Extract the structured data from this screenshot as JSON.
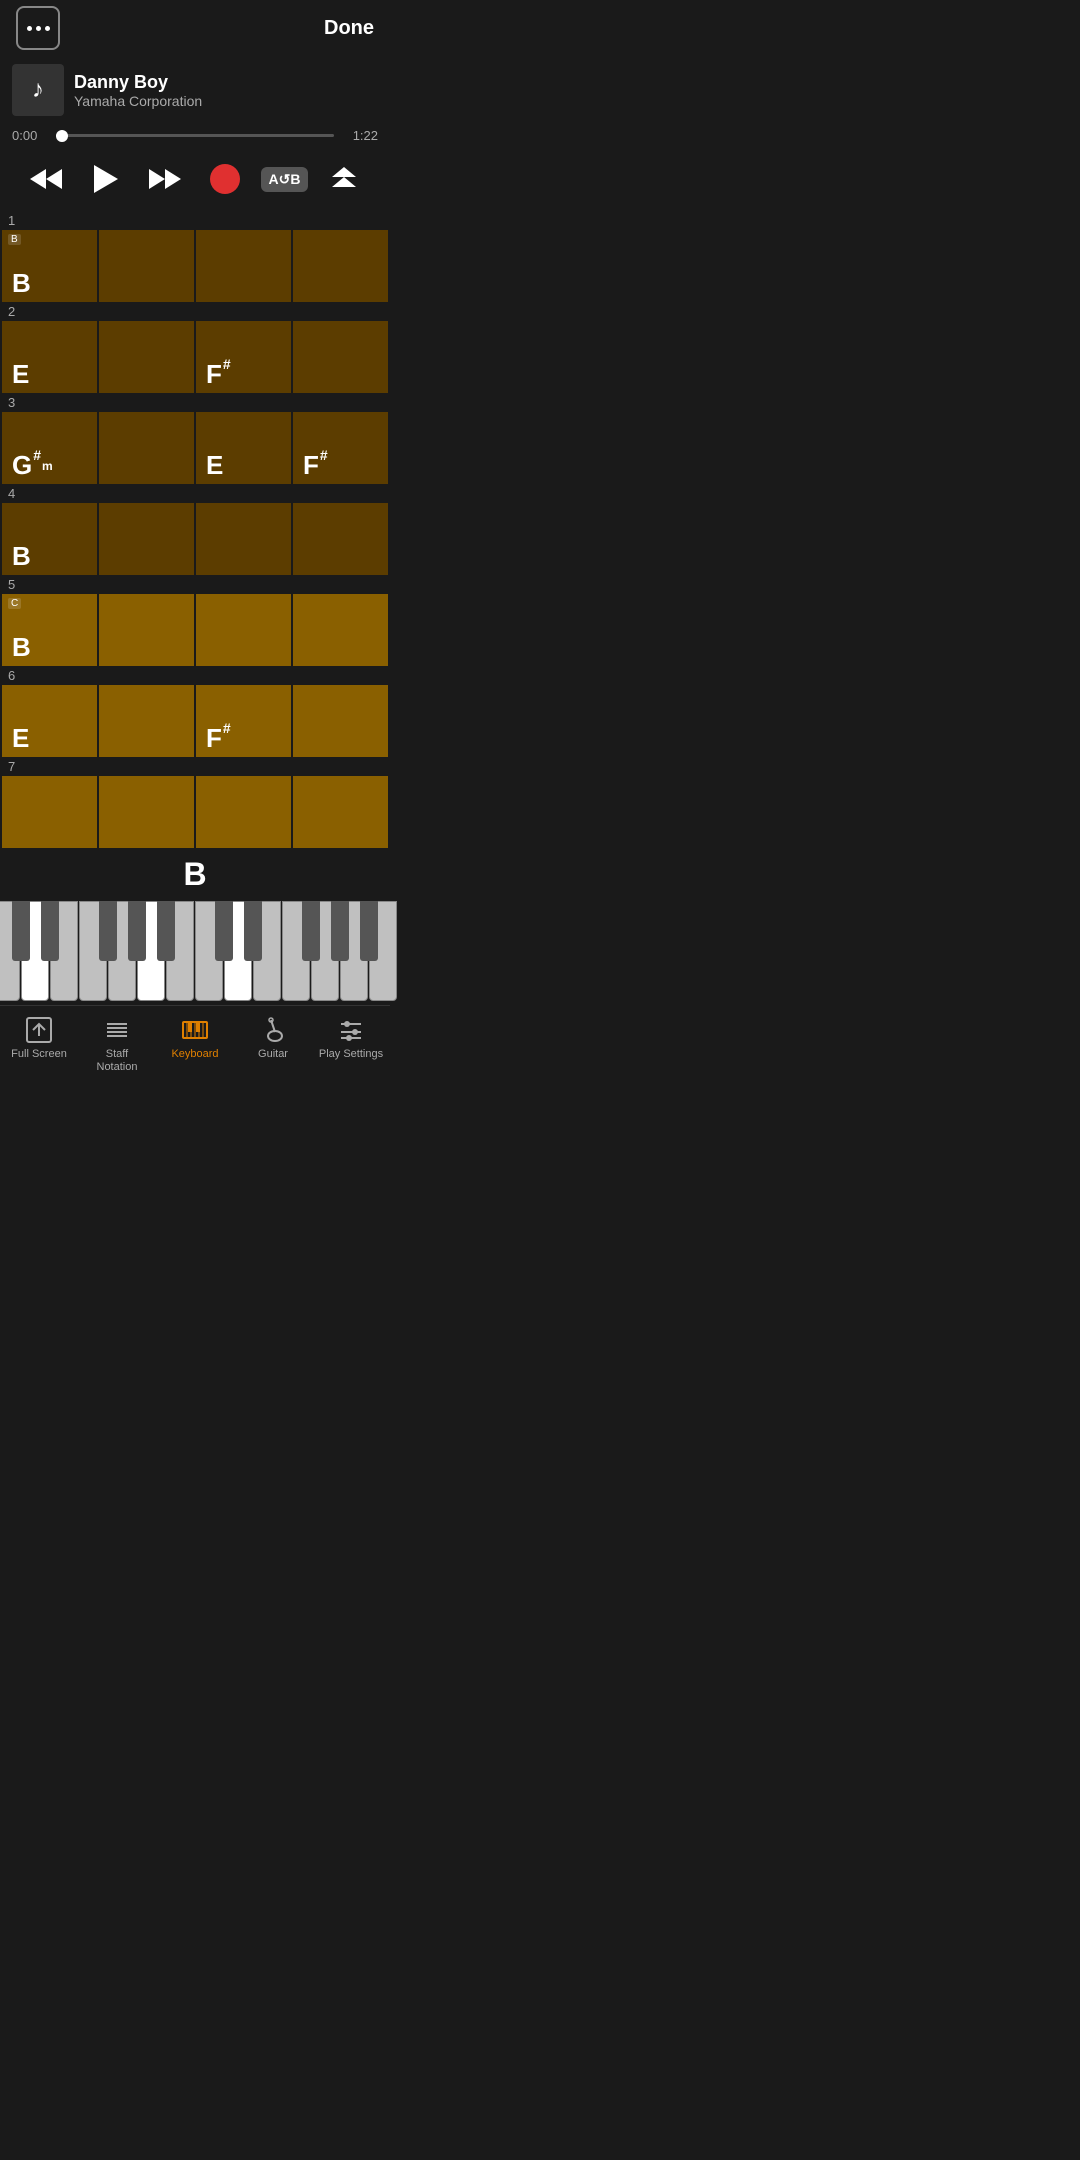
{
  "header": {
    "menu_label": "menu",
    "done_label": "Done"
  },
  "player": {
    "title": "Danny Boy",
    "artist": "Yamaha Corporation",
    "time_current": "0:00",
    "time_total": "1:22",
    "progress_percent": 2
  },
  "controls": {
    "rewind_label": "Rewind",
    "play_label": "Play",
    "fastforward_label": "Fast Forward",
    "record_label": "Record",
    "ab_label": "A↺B",
    "scroll_label": "Scroll"
  },
  "chord_grid": {
    "rows": [
      {
        "number": "1",
        "section": "B",
        "cells": [
          {
            "label": "B",
            "sharp": "",
            "sub": "",
            "style": "dark",
            "section": "B"
          },
          {
            "label": "",
            "sharp": "",
            "sub": "",
            "style": "dark"
          },
          {
            "label": "",
            "sharp": "",
            "sub": "",
            "style": "dark"
          },
          {
            "label": "",
            "sharp": "",
            "sub": "",
            "style": "dark"
          }
        ]
      },
      {
        "number": "2",
        "cells": [
          {
            "label": "E",
            "sharp": "",
            "sub": "",
            "style": "dark"
          },
          {
            "label": "",
            "sharp": "",
            "sub": "",
            "style": "dark"
          },
          {
            "label": "F",
            "sharp": "#",
            "sub": "",
            "style": "dark"
          },
          {
            "label": "",
            "sharp": "",
            "sub": "",
            "style": "dark"
          }
        ]
      },
      {
        "number": "3",
        "cells": [
          {
            "label": "G",
            "sharp": "#",
            "sub": "m",
            "style": "dark"
          },
          {
            "label": "",
            "sharp": "",
            "sub": "",
            "style": "dark"
          },
          {
            "label": "E",
            "sharp": "",
            "sub": "",
            "style": "dark"
          },
          {
            "label": "F",
            "sharp": "#",
            "sub": "",
            "style": "dark"
          }
        ]
      },
      {
        "number": "4",
        "cells": [
          {
            "label": "B",
            "sharp": "",
            "sub": "",
            "style": "dark"
          },
          {
            "label": "",
            "sharp": "",
            "sub": "",
            "style": "dark"
          },
          {
            "label": "",
            "sharp": "",
            "sub": "",
            "style": "dark"
          },
          {
            "label": "",
            "sharp": "",
            "sub": "",
            "style": "dark"
          }
        ]
      },
      {
        "number": "5",
        "section": "C",
        "cells": [
          {
            "label": "B",
            "sharp": "",
            "sub": "",
            "style": "medium",
            "section": "C"
          },
          {
            "label": "",
            "sharp": "",
            "sub": "",
            "style": "medium"
          },
          {
            "label": "",
            "sharp": "",
            "sub": "",
            "style": "medium"
          },
          {
            "label": "",
            "sharp": "",
            "sub": "",
            "style": "medium"
          }
        ]
      },
      {
        "number": "6",
        "cells": [
          {
            "label": "E",
            "sharp": "",
            "sub": "",
            "style": "medium"
          },
          {
            "label": "",
            "sharp": "",
            "sub": "",
            "style": "medium"
          },
          {
            "label": "F",
            "sharp": "#",
            "sub": "",
            "style": "medium"
          },
          {
            "label": "",
            "sharp": "",
            "sub": "",
            "style": "medium"
          }
        ]
      },
      {
        "number": "7",
        "cells": [
          {
            "label": "",
            "sharp": "",
            "sub": "",
            "style": "medium"
          },
          {
            "label": "",
            "sharp": "",
            "sub": "",
            "style": "medium"
          },
          {
            "label": "",
            "sharp": "",
            "sub": "",
            "style": "medium"
          },
          {
            "label": "",
            "sharp": "",
            "sub": "",
            "style": "medium"
          }
        ]
      }
    ]
  },
  "piano": {
    "current_chord": "B",
    "active_keys": [
      1,
      5,
      8
    ]
  },
  "tab_bar": {
    "items": [
      {
        "id": "fullscreen",
        "label": "Full Screen",
        "active": false
      },
      {
        "id": "staff",
        "label": "Staff\nNotation",
        "active": false
      },
      {
        "id": "keyboard",
        "label": "Keyboard",
        "active": true
      },
      {
        "id": "guitar",
        "label": "Guitar",
        "active": false
      },
      {
        "id": "settings",
        "label": "Play Settings",
        "active": false
      }
    ]
  }
}
